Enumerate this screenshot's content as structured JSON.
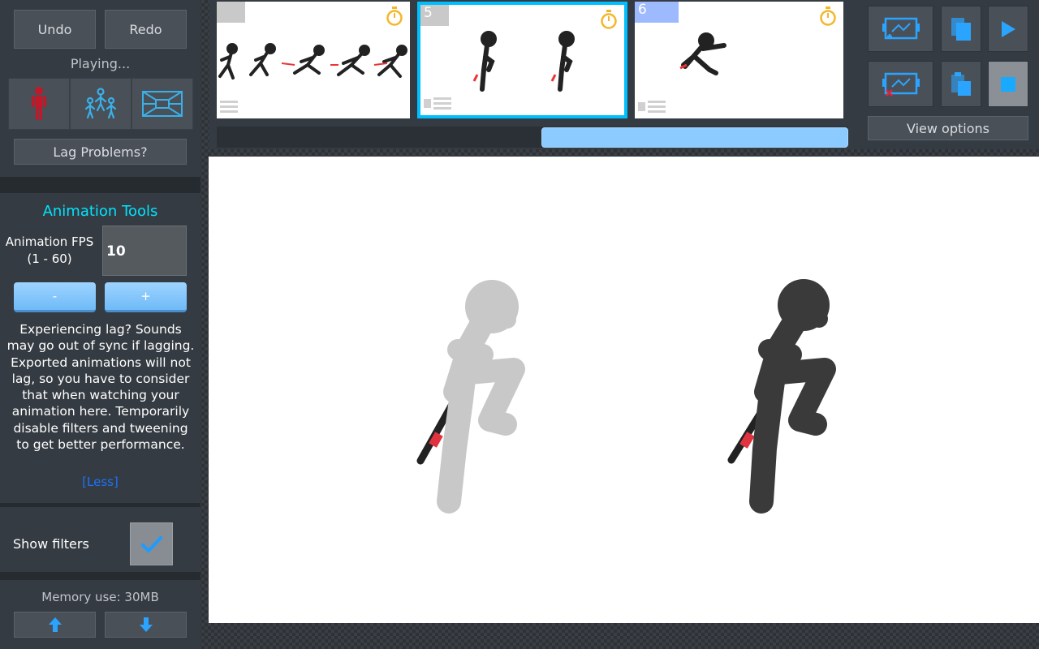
{
  "sidebar": {
    "undo_label": "Undo",
    "redo_label": "Redo",
    "status": "Playing...",
    "lag_problems_label": "Lag Problems?",
    "animation_tools": {
      "heading": "Animation Tools",
      "fps_label": "Animation FPS",
      "fps_range": "(1 - 60)",
      "fps_value": "10",
      "minus_label": "-",
      "plus_label": "+",
      "lag_info": "Experiencing lag? Sounds may go out of sync if lagging. Exported animations will not lag, so you have to consider that when watching your animation here. Temporarily disable filters and tweening to get better performance.",
      "less_link": "[Less]"
    },
    "show_filters_label": "Show filters",
    "show_filters_checked": true,
    "memory_use": "Memory use: 30MB"
  },
  "timeline": {
    "frames": [
      {
        "number": "",
        "selected": false
      },
      {
        "number": "5",
        "selected": true
      },
      {
        "number": "6",
        "selected": false
      }
    ]
  },
  "toolbox": {
    "view_options_label": "View options"
  },
  "colors": {
    "accent_cyan": "#00e5ff",
    "selected_frame": "#00bfff",
    "button_blue": "#8ccbff",
    "timer_orange": "#f5b72a",
    "stop_blue": "#19aaff"
  }
}
